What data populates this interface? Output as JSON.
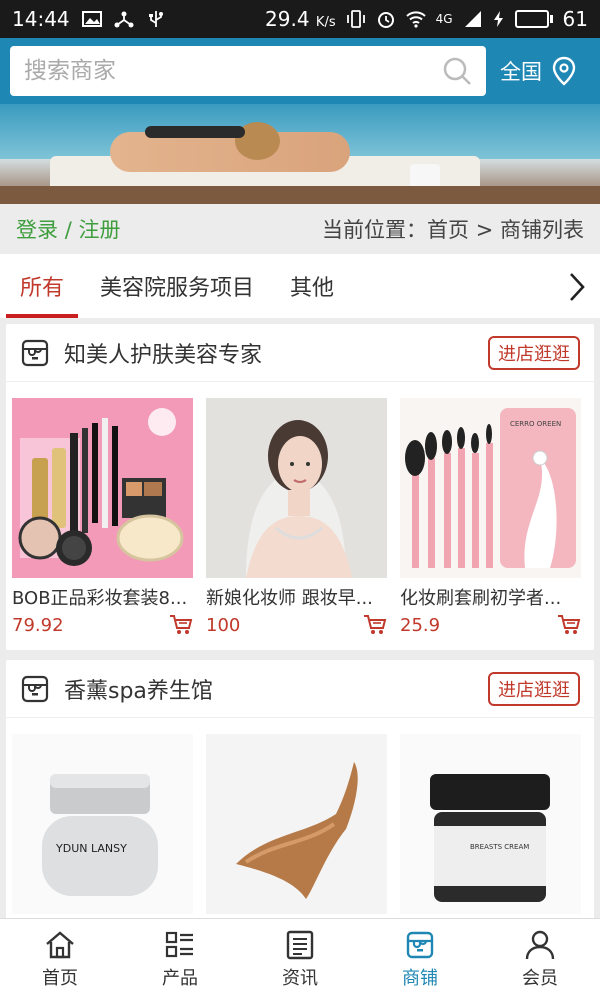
{
  "status_bar": {
    "time": "14:44",
    "speed": "29.4",
    "speed_unit": "K/s",
    "network": "4G",
    "battery": "61",
    "battery_fraction": 0.61,
    "battery_color": "#27d04b"
  },
  "header": {
    "search_placeholder": "搜索商家",
    "region": "全国",
    "brand_color": "#1f87b4"
  },
  "crumb": {
    "login": "登录",
    "separator": "/",
    "register": "注册",
    "position": "当前位置：首页 > 商铺列表"
  },
  "tabs": [
    {
      "label": "所有",
      "active": true
    },
    {
      "label": "美容院服务项目",
      "active": false
    },
    {
      "label": "其他",
      "active": false
    }
  ],
  "shops": [
    {
      "name": "知美人护肤美容专家",
      "enter_label": "进店逛逛",
      "products": [
        {
          "name": "BOB正品彩妆套装8...",
          "price": "79.92"
        },
        {
          "name": "新娘化妆师 跟妆早...",
          "price": "100"
        },
        {
          "name": "化妆刷套刷初学者...",
          "price": "25.9"
        }
      ]
    },
    {
      "name": "香薰spa养生馆",
      "enter_label": "进店逛逛",
      "products": [
        {
          "name": "",
          "price": ""
        },
        {
          "name": "",
          "price": ""
        },
        {
          "name": "",
          "price": ""
        }
      ]
    }
  ],
  "bottom_nav": [
    {
      "label": "首页",
      "icon": "home-icon",
      "active": false
    },
    {
      "label": "产品",
      "icon": "list-icon",
      "active": false
    },
    {
      "label": "资讯",
      "icon": "news-icon",
      "active": false
    },
    {
      "label": "商铺",
      "icon": "shop-icon",
      "active": true
    },
    {
      "label": "会员",
      "icon": "user-icon",
      "active": false
    }
  ],
  "product_image_text": {
    "brush_box": "CERRO OREEN",
    "cream_brand": "YDUN LANSY",
    "jar_label": "BREASTS CREAM"
  }
}
